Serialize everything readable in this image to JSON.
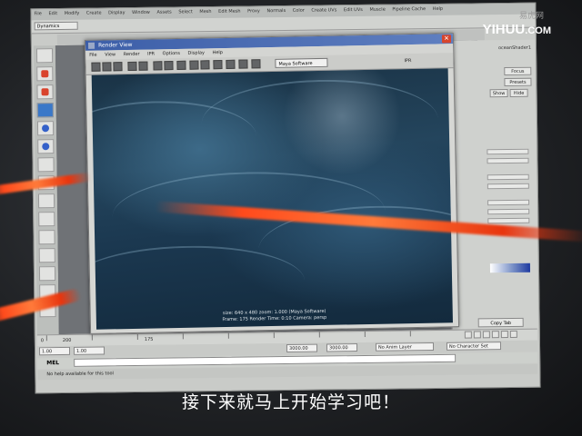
{
  "app": {
    "menus": [
      "File",
      "Edit",
      "Modify",
      "Create",
      "Display",
      "Window",
      "Assets",
      "Select",
      "Mesh",
      "Edit Mesh",
      "Proxy",
      "Normals",
      "Color",
      "Create UVs",
      "Edit UVs",
      "Muscle",
      "Pipeline Cache",
      "Help"
    ],
    "menu_set": "Dynamics"
  },
  "render_view": {
    "title": "Render View",
    "menus": [
      "File",
      "View",
      "Render",
      "IPR",
      "Options",
      "Display",
      "Help"
    ],
    "renderer": "Maya Software",
    "ipr_label": "IPR",
    "overlay_line1": "size: 640 x 480 zoom: 1.000          (Maya Software)",
    "overlay_line2": "Frame: 175    Render Time: 0:10    Camera: persp",
    "close_glyph": "✕"
  },
  "attribute_editor": {
    "tab_label": "oceanShader1",
    "focus_label": "Focus",
    "presets_label": "Presets",
    "show_label": "Show",
    "hide_label": "Hide",
    "copy_tab_label": "Copy Tab"
  },
  "timeline": {
    "start_frame": "0",
    "slider_max": "200",
    "current_frame": "175",
    "playback_start": "1.00",
    "range_start": "1.00",
    "range_end": "3000.00",
    "anim_end": "3000.00",
    "anim_layer": "No Anim Layer",
    "character_set": "No Character Set"
  },
  "command_line": {
    "label": "MEL",
    "help_text": "No help available for this tool"
  },
  "watermark": {
    "main": "YIHUU",
    "domain": ".COM",
    "sub": "易虎网"
  },
  "subtitle": "接下来就马上开始学习吧！"
}
